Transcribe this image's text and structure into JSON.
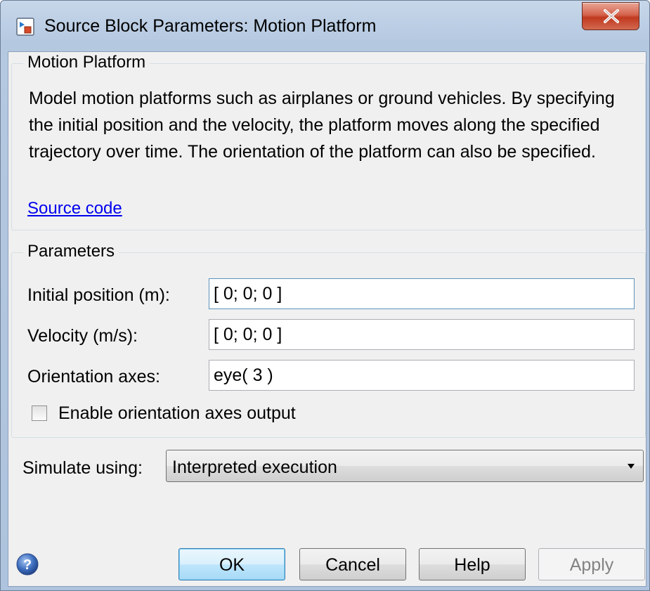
{
  "window": {
    "title": "Source Block Parameters: Motion Platform"
  },
  "description": {
    "group_title": "Motion Platform",
    "text": "Model motion platforms such as airplanes or ground vehicles. By specifying the initial position and the velocity, the platform moves along the specified trajectory over time. The orientation of the platform can also be specified.",
    "source_link": "Source code"
  },
  "parameters": {
    "group_title": "Parameters",
    "initial_position": {
      "label": "Initial position (m):",
      "value": "[ 0; 0; 0 ]"
    },
    "velocity": {
      "label": "Velocity (m/s):",
      "value": "[ 0; 0; 0 ]"
    },
    "orientation_axes": {
      "label": "Orientation axes:",
      "value": "eye( 3 )"
    },
    "enable_orientation_output": {
      "label": "Enable orientation axes output",
      "checked": false
    }
  },
  "simulate": {
    "label": "Simulate using:",
    "selected": "Interpreted execution"
  },
  "buttons": {
    "ok": "OK",
    "cancel": "Cancel",
    "help": "Help",
    "apply": "Apply"
  },
  "icons": {
    "app": "simulink-block-icon",
    "close": "close-icon",
    "help": "help-icon"
  },
  "colors": {
    "link": "#0000ee",
    "close_button": "#c7432b",
    "default_button_border": "#3c7fb1",
    "disabled_text": "#838383"
  }
}
